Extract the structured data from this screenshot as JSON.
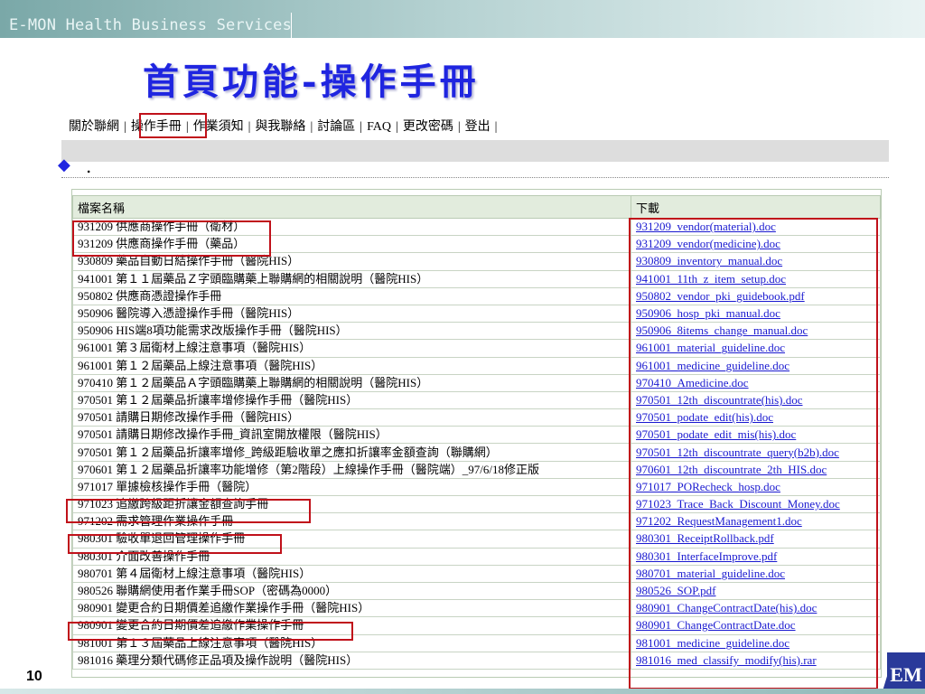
{
  "header": {
    "brand": "E-MON Health Business Services"
  },
  "title": "首頁功能-操作手冊",
  "nav": {
    "items": [
      "關於聯網",
      "操作手冊",
      "作業須知",
      "與我聯絡",
      "討論區",
      "FAQ",
      "更改密碼",
      "登出"
    ],
    "separator": "|"
  },
  "bullet": {
    "diamond": "◆",
    "dot": "."
  },
  "table": {
    "headers": [
      "檔案名稱",
      "下載"
    ],
    "rows": [
      {
        "name": "931209 供應商操作手冊（衛材）",
        "link": "931209_vendor(material).doc"
      },
      {
        "name": "931209 供應商操作手冊（藥品）",
        "link": "931209_vendor(medicine).doc"
      },
      {
        "name": "930809 藥品自動日結操作手冊（醫院HIS）",
        "link": "930809_inventory_manual.doc"
      },
      {
        "name": "941001 第１１屆藥品Ｚ字頭臨購藥上聯購網的相關說明（醫院HIS）",
        "link": "941001_11th_z_item_setup.doc"
      },
      {
        "name": "950802 供應商憑證操作手冊",
        "link": "950802_vendor_pki_guidebook.pdf"
      },
      {
        "name": "950906 醫院導入憑證操作手冊（醫院HIS）",
        "link": "950906_hosp_pki_manual.doc"
      },
      {
        "name": "950906 HIS端8項功能需求改版操作手冊（醫院HIS）",
        "link": "950906_8items_change_manual.doc"
      },
      {
        "name": "961001 第３屆衛材上線注意事項（醫院HIS）",
        "link": "961001_material_guideline.doc"
      },
      {
        "name": "961001 第１２屆藥品上線注意事項（醫院HIS）",
        "link": "961001_medicine_guideline.doc"
      },
      {
        "name": "970410 第１２屆藥品Ａ字頭臨購藥上聯購網的相關說明（醫院HIS）",
        "link": "970410_Amedicine.doc"
      },
      {
        "name": "970501 第１２屆藥品折讓率增修操作手冊（醫院HIS）",
        "link": "970501_12th_discountrate(his).doc"
      },
      {
        "name": "970501 請購日期修改操作手冊（醫院HIS）",
        "link": "970501_podate_edit(his).doc"
      },
      {
        "name": "970501 請購日期修改操作手冊_資訊室開放權限（醫院HIS）",
        "link": "970501_podate_edit_mis(his).doc"
      },
      {
        "name": "970501 第１２屆藥品折讓率增修_跨級距驗收單之應扣折讓率金額查詢（聯購網）",
        "link": "970501_12th_discountrate_query(b2b).doc"
      },
      {
        "name": "970601 第１２屆藥品折讓率功能增修（第2階段）上線操作手冊（醫院端）_97/6/18修正版",
        "link": "970601_12th_discountrate_2th_HIS.doc"
      },
      {
        "name": "971017 單據檢核操作手冊（醫院）",
        "link": "971017_PORecheck_hosp.doc"
      },
      {
        "name": "971023 追繳跨級距折讓金額查詢手冊",
        "link": "971023_Trace_Back_Discount_Money.doc"
      },
      {
        "name": "971202 需求管理作業操作手冊",
        "link": "971202_RequestManagement1.doc"
      },
      {
        "name": "980301 驗收單退回管理操作手冊",
        "link": "980301_ReceiptRollback.pdf"
      },
      {
        "name": "980301 介面改善操作手冊",
        "link": "980301_InterfaceImprove.pdf"
      },
      {
        "name": "980701 第４屆衛材上線注意事項（醫院HIS）",
        "link": "980701_material_guideline.doc"
      },
      {
        "name": "980526 聯購網使用者作業手冊SOP（密碼為0000）",
        "link": "980526_SOP.pdf"
      },
      {
        "name": "980901 變更合約日期價差追繳作業操作手冊（醫院HIS）",
        "link": "980901_ChangeContractDate(his).doc"
      },
      {
        "name": "980901 變更合約日期價差追繳作業操作手冊",
        "link": "980901_ChangeContractDate.doc"
      },
      {
        "name": "981001 第１３屆藥品上線注意事項（醫院HIS）",
        "link": "981001_medicine_guideline.doc"
      },
      {
        "name": "981016 藥理分類代碼修正品項及操作說明（醫院HIS）",
        "link": "981016_med_classify_modify(his).rar"
      }
    ]
  },
  "page_number": "10",
  "logo": {
    "text": "EM",
    "color": "#2a3a9a"
  },
  "colors": {
    "title": "#1f25e0",
    "highlight": "#c0111a",
    "link": "#1a1ad0"
  }
}
